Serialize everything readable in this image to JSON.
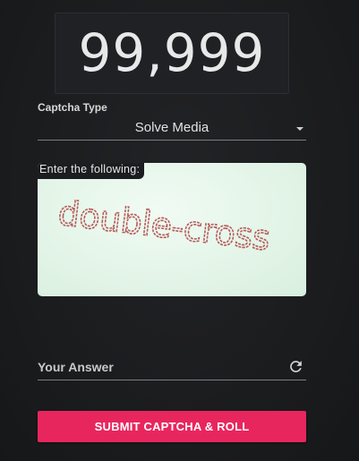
{
  "counter": {
    "value": "99,999"
  },
  "captcha_type": {
    "label": "Captcha Type",
    "selected": "Solve Media"
  },
  "captcha": {
    "prompt": "Enter the following:",
    "image_text": "double-cross"
  },
  "answer": {
    "placeholder": "Your Answer",
    "value": ""
  },
  "icons": {
    "refresh": "refresh-icon",
    "dropdown": "chevron-down-icon"
  },
  "submit": {
    "label": "SUBMIT CAPTCHA & ROLL"
  },
  "colors": {
    "background": "#1b1c1e",
    "accent": "#e8265e",
    "captcha_bg": "#e6f6ea",
    "captcha_text": "#b65a5a"
  }
}
